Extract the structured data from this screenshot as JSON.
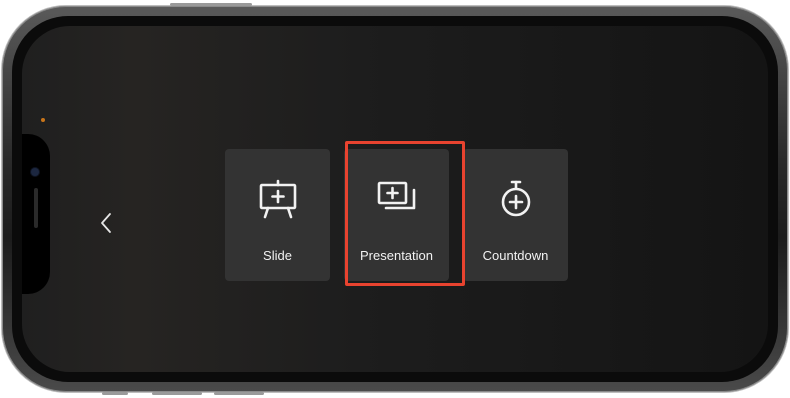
{
  "nav": {
    "back_icon": "chevron-left-icon"
  },
  "options": [
    {
      "id": "slide",
      "label": "Slide",
      "icon": "easel-plus-icon"
    },
    {
      "id": "presentation",
      "label": "Presentation",
      "icon": "stacked-slides-plus-icon",
      "selected": true
    },
    {
      "id": "countdown",
      "label": "Countdown",
      "icon": "stopwatch-plus-icon"
    }
  ],
  "colors": {
    "highlight": "#e8432f",
    "card": "#333333",
    "text": "#f2f2f2"
  }
}
